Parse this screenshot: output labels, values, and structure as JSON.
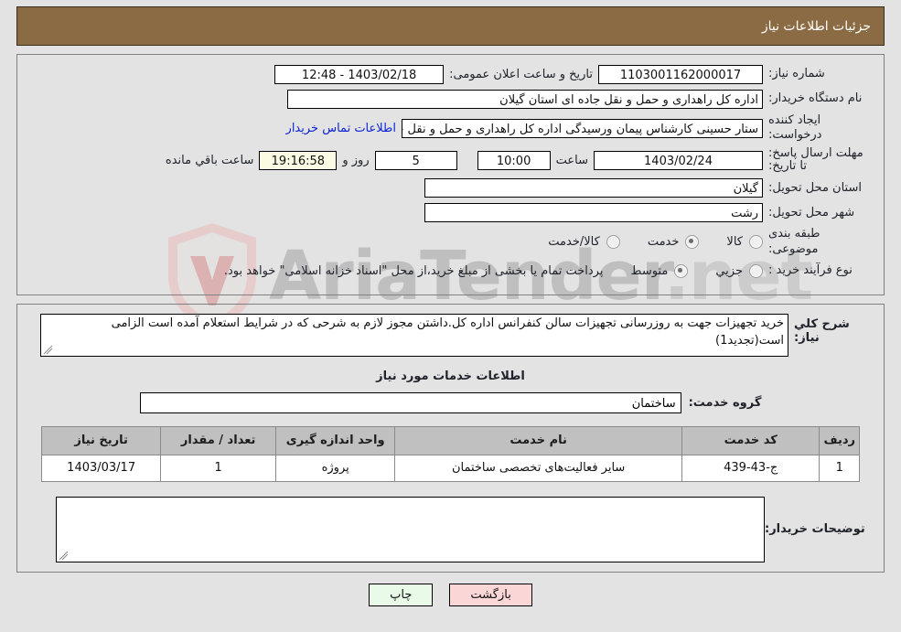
{
  "header": {
    "title": "جزئیات اطلاعات نیاز"
  },
  "watermark": {
    "text": "AriaTender",
    "suffix": ".net"
  },
  "top_form": {
    "need_number_label": "شماره نیاز:",
    "need_number_value": "1103001162000017",
    "public_announce_label": "تاریخ و ساعت اعلان عمومی:",
    "public_announce_value": "1403/02/18 - 12:48",
    "buyer_org_label": "نام دستگاه خریدار:",
    "buyer_org_value": "اداره کل راهداری و حمل و نقل جاده ای استان گیلان",
    "creator_label": "ایجاد کننده درخواست:",
    "creator_value": "ستار حسینی کارشناس پیمان ورسیدگی اداره کل راهداری و حمل و نقل جاده ای",
    "contact_link": "اطلاعات تماس خریدار",
    "deadline_label": "مهلت ارسال پاسخ: تا تاریخ:",
    "deadline_date": "1403/02/24",
    "hour_label": "ساعت",
    "hour_value": "10:00",
    "days_value": "5",
    "days_label": "روز و",
    "countdown_value": "19:16:58",
    "remaining_label": "ساعت باقي مانده",
    "province_label": "استان محل تحویل:",
    "province_value": "گیلان",
    "city_label": "شهر محل تحویل:",
    "city_value": "رشت",
    "category_label": "طبقه بندی موضوعی:",
    "category_options": [
      {
        "label": "کالا",
        "checked": false
      },
      {
        "label": "خدمت",
        "checked": true
      },
      {
        "label": "کالا/خدمت",
        "checked": false
      }
    ],
    "process_label": "نوع فرآیند خرید :",
    "process_options": [
      {
        "label": "جزیي",
        "checked": false
      },
      {
        "label": "متوسط",
        "checked": true
      }
    ],
    "payment_note": "پرداخت تمام یا بخشی از مبلغ خرید،از محل \"اسناد خزانه اسلامی\" خواهد بود."
  },
  "bottom": {
    "desc_label": "شرح کلي نیاز:",
    "desc_value": "خرید تجهیزات جهت به روزرسانی تجهیزات سالن کنفرانس اداره کل.داشتن مجوز لازم به شرحی که در شرایط استعلام آمده است الزامی است(تجدید1)",
    "services_heading": "اطلاعات خدمات مورد نیاز",
    "service_group_label": "گروه خدمت:",
    "service_group_value": "ساختمان",
    "table": {
      "columns": [
        "ردیف",
        "کد خدمت",
        "نام خدمت",
        "واحد اندازه گیری",
        "تعداد / مقدار",
        "تاریخ نیاز"
      ],
      "rows": [
        {
          "radif": "1",
          "code": "ج-43-439",
          "name": "سایر فعالیت‌های تخصصی ساختمان",
          "unit": "پروژه",
          "qty": "1",
          "date": "1403/03/17"
        }
      ]
    },
    "buyer_notes_label": "توضیحات خریدار:",
    "buyer_notes_value": ""
  },
  "footer": {
    "print_label": "چاپ",
    "back_label": "بازگشت"
  },
  "colors": {
    "header_bg": "#8b6b43",
    "page_bg": "#e3e3e3",
    "link": "#0d24d6",
    "print_btn": "#eafae8",
    "back_btn": "#fad6d6",
    "table_header": "#c0c0c0",
    "countdown_bg": "#fbfbe4"
  }
}
